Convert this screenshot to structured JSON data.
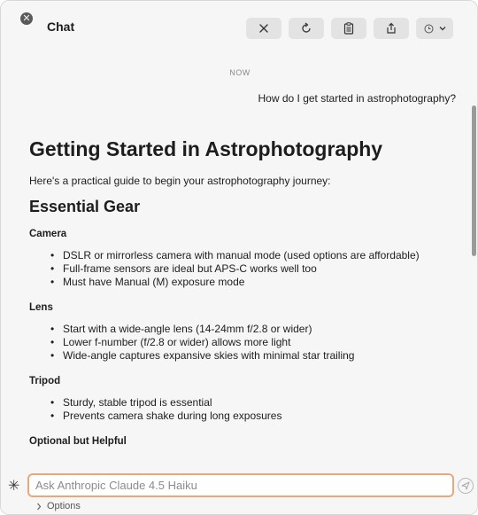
{
  "window": {
    "title": "Chat"
  },
  "toolbar": {
    "close_icon": "x-mark-icon",
    "refresh_icon": "reload-icon",
    "copy_icon": "clipboard-icon",
    "share_icon": "share-icon",
    "more_icon": "options-dropdown-icon"
  },
  "conversation": {
    "timestamp": "NOW",
    "user_message": "How do I get started in astrophotography?",
    "response": {
      "title": "Getting Started in Astrophotography",
      "intro": "Here's a practical guide to begin your astrophotography journey:",
      "section_heading": "Essential Gear",
      "camera": {
        "heading": "Camera",
        "items": [
          "DSLR or mirrorless camera with manual mode (used options are affordable)",
          "Full-frame sensors are ideal but APS-C works well too",
          "Must have Manual (M) exposure mode"
        ]
      },
      "lens": {
        "heading": "Lens",
        "items": [
          "Start with a wide-angle lens (14-24mm f/2.8 or wider)",
          "Lower f-number (f/2.8 or wider) allows more light",
          "Wide-angle captures expansive skies with minimal star trailing"
        ]
      },
      "tripod": {
        "heading": "Tripod",
        "items": [
          "Sturdy, stable tripod is essential",
          "Prevents camera shake during long exposures"
        ]
      },
      "optional_heading": "Optional but Helpful"
    }
  },
  "input": {
    "placeholder": "Ask Anthropic Claude 4.5 Haiku",
    "value": "",
    "options_label": "Options"
  },
  "colors": {
    "accent_border": "#e8a87c"
  }
}
